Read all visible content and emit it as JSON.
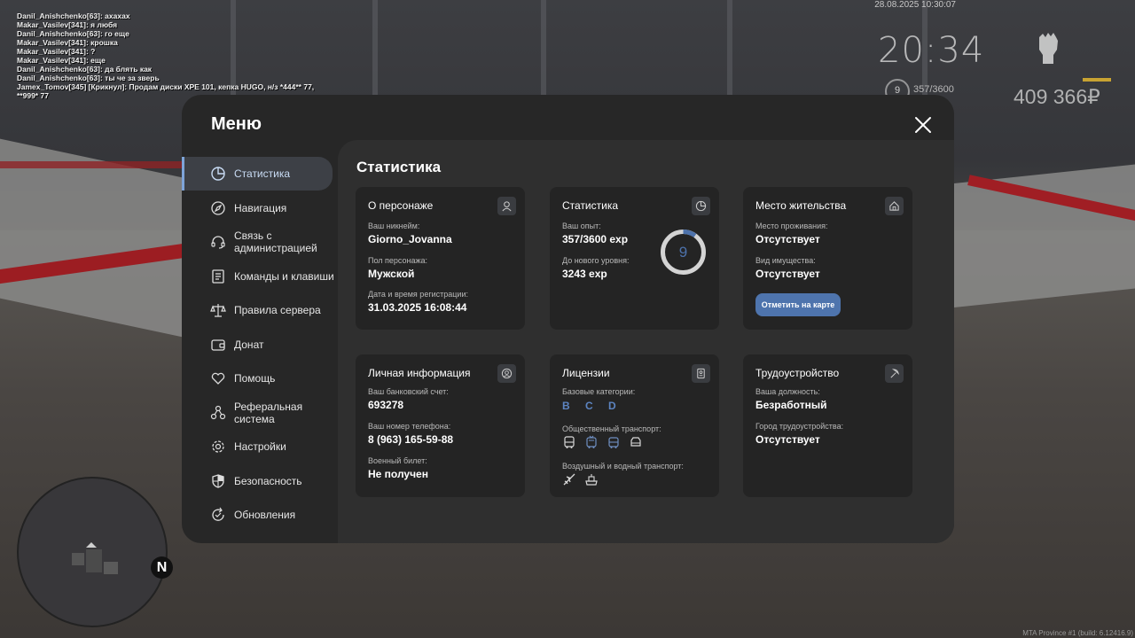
{
  "chat": [
    "Danil_Anishchenko[63]: ахахах",
    "Makar_Vasilev[341]: я любя",
    "Danil_Anishchenko[63]: го еще",
    "Makar_Vasilev[341]: крошка",
    "Makar_Vasilev[341]: ?",
    "Makar_Vasilev[341]: еще",
    "Danil_Anishchenko[63]: да блять как",
    "Danil_Anishchenko[63]: ты че за зверь",
    "Jamex_Tomov[345] [Крикнул]: Продам диски XPE 101, кепка HUGO, н/з *444** 77,\n**999* 77"
  ],
  "hud": {
    "datetime": "28.08.2025 10:30:07",
    "time": "20:34",
    "level": "9",
    "exp": "357/3600",
    "money": "409 366₽",
    "build": "MTA Province #1 (build: 6.12416.9)"
  },
  "minimap": {
    "north": "N"
  },
  "menu": {
    "title": "Меню",
    "sidebar": [
      {
        "label": "Статистика",
        "icon": "pie-chart-icon",
        "active": true
      },
      {
        "label": "Навигация",
        "icon": "compass-icon"
      },
      {
        "label": "Связь с администрацией",
        "icon": "headset-icon"
      },
      {
        "label": "Команды и клавиши",
        "icon": "document-icon"
      },
      {
        "label": "Правила сервера",
        "icon": "scales-icon"
      },
      {
        "label": "Донат",
        "icon": "wallet-icon"
      },
      {
        "label": "Помощь",
        "icon": "heart-hand-icon"
      },
      {
        "label": "Реферальная система",
        "icon": "referral-icon"
      },
      {
        "label": "Настройки",
        "icon": "gear-icon"
      },
      {
        "label": "Безопасность",
        "icon": "shield-icon"
      },
      {
        "label": "Обновления",
        "icon": "refresh-icon"
      }
    ],
    "content_title": "Статистика",
    "cards": {
      "character": {
        "title": "О персонаже",
        "nickname_label": "Ваш никнейм:",
        "nickname": "Giorno_Jovanna",
        "gender_label": "Пол персонажа:",
        "gender": "Мужской",
        "reg_label": "Дата и время регистрации:",
        "reg": "31.03.2025 16:08:44"
      },
      "stats": {
        "title": "Статистика",
        "exp_label": "Ваш опыт:",
        "exp": "357/3600 exp",
        "next_label": "До нового уровня:",
        "next": "3243 exp",
        "level": "9",
        "progress": 0.099
      },
      "residence": {
        "title": "Место жительства",
        "place_label": "Место проживания:",
        "place": "Отсутствует",
        "property_label": "Вид имущества:",
        "property": "Отсутствует",
        "map_button": "Отметить на карте"
      },
      "personal": {
        "title": "Личная информация",
        "bank_label": "Ваш банковский счет:",
        "bank": "693278",
        "phone_label": "Ваш номер телефона:",
        "phone": "8 (963) 165-59-88",
        "military_label": "Военный билет:",
        "military": "Не получен"
      },
      "licenses": {
        "title": "Лицензии",
        "base_label": "Базовые категории:",
        "base": "B C D",
        "public_label": "Общественный транспорт:",
        "air_label": "Воздушный и водный транспорт:"
      },
      "job": {
        "title": "Трудоустройство",
        "position_label": "Ваша должность:",
        "position": "Безработный",
        "city_label": "Город трудоустройства:",
        "city": "Отсутствует"
      }
    }
  }
}
